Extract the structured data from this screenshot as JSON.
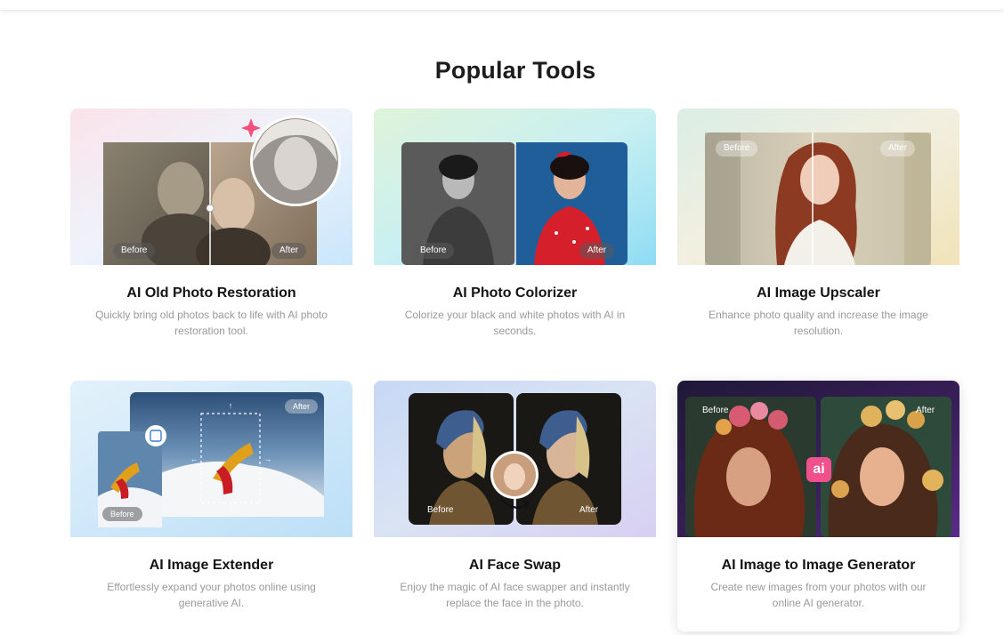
{
  "section": {
    "title": "Popular Tools"
  },
  "cards": [
    {
      "title": "AI Old Photo Restoration",
      "description": "Quickly bring old photos back to life with AI photo restoration tool.",
      "before": "Before",
      "after": "After"
    },
    {
      "title": "AI Photo Colorizer",
      "description": "Colorize your black and white photos with AI in seconds.",
      "before": "Before",
      "after": "After"
    },
    {
      "title": "AI Image Upscaler",
      "description": "Enhance photo quality and increase the image resolution.",
      "before": "Before",
      "after": "After"
    },
    {
      "title": "AI Image Extender",
      "description": "Effortlessly expand your photos online using generative AI.",
      "before": "Before",
      "after": "After"
    },
    {
      "title": "AI Face Swap",
      "description": "Enjoy the magic of AI face swapper and instantly replace the face in the photo.",
      "before": "Before",
      "after": "After"
    },
    {
      "title": "AI Image to Image Generator",
      "description": "Create new images from your photos with our online AI generator.",
      "before": "Before",
      "after": "After",
      "badge": "ai"
    }
  ],
  "colors": {
    "accent_pink": "#f0508c",
    "sparkle": "#f24f7a"
  }
}
